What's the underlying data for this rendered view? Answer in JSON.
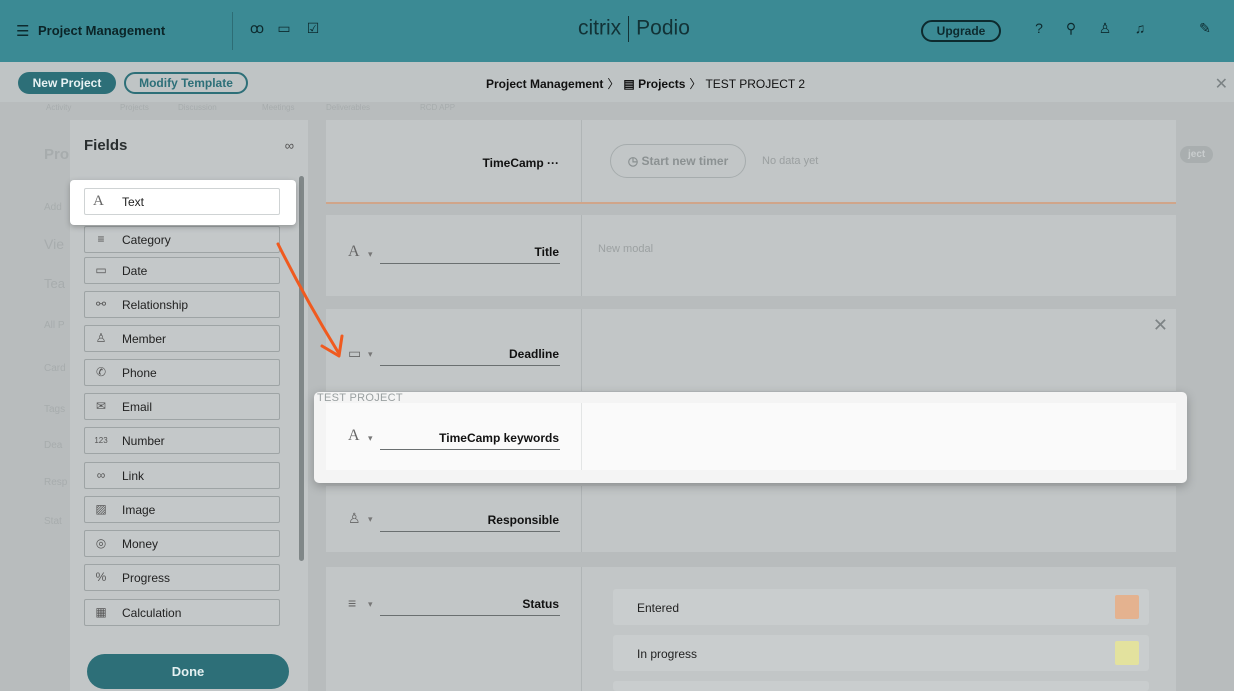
{
  "topbar": {
    "app_name": "Project Management",
    "brand_left": "citrix",
    "brand_right": "Podio",
    "upgrade_label": "Upgrade",
    "icons": [
      "contacts-icon",
      "calendar-icon",
      "tasks-icon",
      "help-icon",
      "search-icon",
      "profile-icon",
      "notifications-icon",
      "chat-icon"
    ]
  },
  "subbar": {
    "new_project_label": "New Project",
    "modify_template_label": "Modify Template",
    "breadcrumb": [
      "Project Management",
      "Projects",
      "TEST PROJECT 2"
    ]
  },
  "background": {
    "tabs": [
      "Activity",
      "Projects",
      "Discussion",
      "Meetings",
      "Deliverables",
      "RCD APP"
    ],
    "left_labels": [
      "Pro",
      "Add",
      "Vie",
      "Tea",
      "All P",
      "Card",
      "Tags",
      "Dea",
      "Resp",
      "Stat"
    ],
    "right_badge": "ject"
  },
  "fields_panel": {
    "title": "Fields",
    "items": [
      {
        "label": "Text",
        "icon": "text-icon",
        "glyph": "A"
      },
      {
        "label": "Category",
        "icon": "category-icon",
        "glyph": "≡"
      },
      {
        "label": "Date",
        "icon": "calendar-icon",
        "glyph": "▭"
      },
      {
        "label": "Relationship",
        "icon": "relationship-icon",
        "glyph": "⚯"
      },
      {
        "label": "Member",
        "icon": "member-icon",
        "glyph": "♙"
      },
      {
        "label": "Phone",
        "icon": "phone-icon",
        "glyph": "✆"
      },
      {
        "label": "Email",
        "icon": "email-icon",
        "glyph": "✉"
      },
      {
        "label": "Number",
        "icon": "number-icon",
        "glyph": "123"
      },
      {
        "label": "Link",
        "icon": "link-icon",
        "glyph": "∞"
      },
      {
        "label": "Image",
        "icon": "image-icon",
        "glyph": "▨"
      },
      {
        "label": "Money",
        "icon": "money-icon",
        "glyph": "◎"
      },
      {
        "label": "Progress",
        "icon": "progress-icon",
        "glyph": "%"
      },
      {
        "label": "Calculation",
        "icon": "calculation-icon",
        "glyph": "▦"
      }
    ],
    "done_label": "Done"
  },
  "form": {
    "timecamp_label": "TimeCamp ···",
    "start_timer_label": "Start new timer",
    "no_data": "No data yet",
    "title_label": "Title",
    "title_value": "New modal",
    "deadline_label": "Deadline",
    "highlight_tag": "TEST PROJECT",
    "keywords_label": "TimeCamp keywords",
    "responsible_label": "Responsible",
    "status_label": "Status",
    "status_options": [
      {
        "label": "Entered",
        "color": "#e4b28f"
      },
      {
        "label": "In progress",
        "color": "#e3e29e"
      }
    ]
  },
  "colors": {
    "accent": "#2d6f78",
    "topbar": "#3b8a94",
    "arrow": "#f05a1f"
  }
}
